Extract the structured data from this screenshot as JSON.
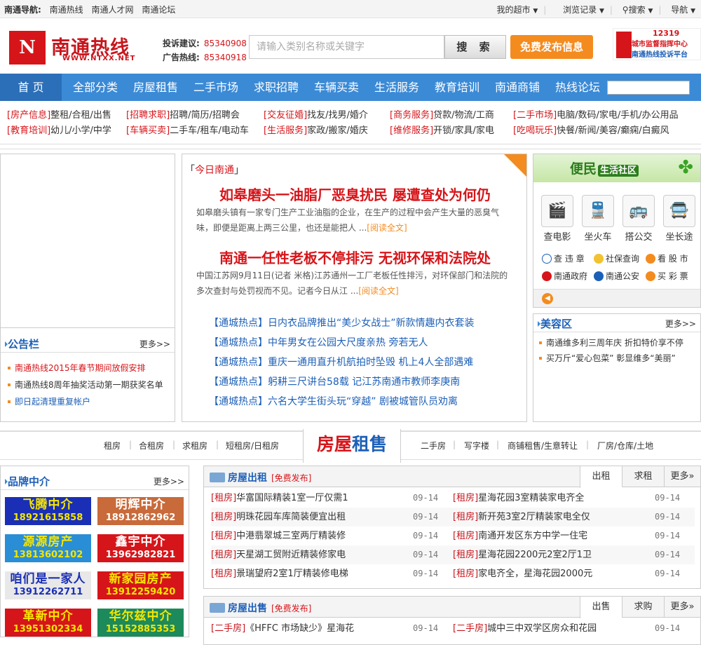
{
  "topbar": {
    "nav_label": "南通导航:",
    "links": [
      "南通热线",
      "南通人才网",
      "南通论坛"
    ],
    "right": [
      "我的超市",
      "浏览记录",
      "搜索",
      "导航"
    ]
  },
  "header": {
    "logo_mark": "N",
    "logo_name": "南通热线",
    "logo_url": "WWW.NTXX.NET",
    "hotline": [
      {
        "label": "投诉建议:",
        "num": "85340908"
      },
      {
        "label": "广告热线:",
        "num": "85340918"
      }
    ],
    "search_placeholder": "请输入类别名称或关键字",
    "search_button": "搜 索",
    "post_button": "免费发布信息",
    "ad": {
      "num": "12319",
      "l1": "城市监督指挥中心",
      "l2": "南通热线投诉平台"
    }
  },
  "nav": [
    "首 页",
    "全部分类",
    "房屋租售",
    "二手市场",
    "求职招聘",
    "车辆买卖",
    "生活服务",
    "教育培训",
    "南通商铺",
    "热线论坛"
  ],
  "categories": [
    [
      {
        "k": "[房产信息]",
        "v": "整租/合租/出售"
      },
      {
        "k": "[招聘求职]",
        "v": "招聘/简历/招聘会"
      },
      {
        "k": "[交友征婚]",
        "v": "找友/找男/婚介"
      },
      {
        "k": "[商务服务]",
        "v": "贷款/物流/工商"
      },
      {
        "k": "[二手市场]",
        "v": "电脑/数码/家电/手机/办公用品"
      }
    ],
    [
      {
        "k": "[教育培训]",
        "v": "幼儿/小学/中学"
      },
      {
        "k": "[车辆买卖]",
        "v": "二手车/租车/电动车"
      },
      {
        "k": "[生活服务]",
        "v": "家政/搬家/婚庆"
      },
      {
        "k": "[维修服务]",
        "v": "开锁/家具/家电"
      },
      {
        "k": "[吃喝玩乐]",
        "v": "快餐/新闻/美容/癫痫/白癜风"
      }
    ]
  ],
  "notice": {
    "title": "公告栏",
    "more": "更多>>",
    "items": [
      "南通热线2015年春节期间放假安排",
      "南通热线8周年抽奖活动第一期获奖名单",
      "即日起清理重复帐户"
    ]
  },
  "today": {
    "label_l": "「",
    "label": "今日南通",
    "label_r": "」",
    "articles": [
      {
        "title": "如皋磨头一油脂厂恶臭扰民 屡遭查处为何仍",
        "summary": "如皋磨头镇有一家专门生产工业油脂的企业，在生产的过程中会产生大量的恶臭气味，即便是距离上两三公里，也还是能把人 ...",
        "more": "[阅读全文]"
      },
      {
        "title": "南通一任性老板不停排污 无视环保和法院处",
        "summary": "中国江苏网9月11日(记者 米格)江苏通州一工厂老板任性排污，对环保部门和法院的多次查封与处罚视而不见。记者今日从江 ...",
        "more": "[阅读全文]"
      }
    ],
    "hot_tag": "【通城热点】",
    "hot": [
      "日内衣品牌推出“美少女战士”新款情趣内衣套装",
      "中年男女在公园大尺度亲热 旁若无人",
      "重庆一通用直升机航拍时坠毁 机上4人全部遇难",
      "躬耕三尺讲台58载 记江苏南通市教师李庚南",
      "六名大学生街头玩“穿越” 剧被城管队员劝离"
    ]
  },
  "community": {
    "title": "便民",
    "title2": "生活社区",
    "services": [
      {
        "icon": "🎬",
        "label": "查电影"
      },
      {
        "icon": "🚆",
        "label": "坐火车"
      },
      {
        "icon": "🚌",
        "label": "搭公交"
      },
      {
        "icon": "🚍",
        "label": "坐长途"
      }
    ],
    "links": [
      {
        "label": "查 违 章",
        "color": "#ffffff"
      },
      {
        "label": "社保查询",
        "color": "#f2c230"
      },
      {
        "label": "看 股 市",
        "color": "#f48b1f"
      },
      {
        "label": "南通政府",
        "color": "#d6151a"
      },
      {
        "label": "南通公安",
        "color": "#1c5fb7"
      },
      {
        "label": "买 彩 票",
        "color": "#f48b1f"
      }
    ]
  },
  "beauty": {
    "title": "美容区",
    "more": "更多>>",
    "items": [
      "南通维多利三周年庆 折扣特价享不停",
      "买万斤“爱心包菜” 彰显维多“美丽”"
    ]
  },
  "house": {
    "left_links": [
      "租房",
      "合租房",
      "求租房",
      "短租房/日租房"
    ],
    "title1": "房屋",
    "title2": "租售",
    "right_links": [
      "二手房",
      "写字楼",
      "商铺租售/生意转让",
      "厂房/仓库/土地"
    ]
  },
  "brand": {
    "title": "品牌中介",
    "more": "更多>>",
    "items": [
      {
        "name": "飞腾中介",
        "phone": "18921615858",
        "bg": "#1a2fb5",
        "fg": "#f5e600"
      },
      {
        "name": "明辉中介",
        "phone": "18912862962",
        "bg": "#c96a3a",
        "fg": "#ffffff"
      },
      {
        "name": "源源房产",
        "phone": "13813602102",
        "bg": "#2a8ed6",
        "fg": "#f5e600"
      },
      {
        "name": "鑫宇中介",
        "phone": "13962982821",
        "bg": "#d6151a",
        "fg": "#ffffff"
      },
      {
        "name": "咱们是一家人",
        "phone": "13912262711",
        "bg": "#e8e8e8",
        "fg": "#1a2fb5"
      },
      {
        "name": "新家园房产",
        "phone": "13912259420",
        "bg": "#d6151a",
        "fg": "#f5e600"
      },
      {
        "name": "革新中介",
        "phone": "13951302334",
        "bg": "#d6151a",
        "fg": "#f5e600"
      },
      {
        "name": "华尔兹中介",
        "phone": "15152885353",
        "bg": "#1c8a5a",
        "fg": "#f5e600"
      }
    ]
  },
  "rent": {
    "title": "房屋出租",
    "free": "[免费发布]",
    "tabs": [
      "出租",
      "求租",
      "更多"
    ],
    "left": [
      {
        "k": "[租房]",
        "t": "华富国际精装1室一厅仅需1",
        "d": "09-14"
      },
      {
        "k": "[租房]",
        "t": "明珠花园车库简装便宜出租",
        "d": "09-14"
      },
      {
        "k": "[租房]",
        "t": "中港翡翠城三室两厅精装修",
        "d": "09-14"
      },
      {
        "k": "[租房]",
        "t": "天星湖工贸附近精装修家电",
        "d": "09-14"
      },
      {
        "k": "[租房]",
        "t": "景瑞望府2室1厅精装修电梯",
        "d": "09-14"
      }
    ],
    "right": [
      {
        "k": "[租房]",
        "t": "星海花园3室精装家电齐全",
        "d": "09-14"
      },
      {
        "k": "[租房]",
        "t": "新开苑3室2厅精装家电全仅",
        "d": "09-14"
      },
      {
        "k": "[租房]",
        "t": "南通开发区东方中学一住宅",
        "d": "09-14"
      },
      {
        "k": "[租房]",
        "t": "星海花园2200元2室2厅1卫",
        "d": "09-14"
      },
      {
        "k": "[租房]",
        "t": "家电齐全，星海花园2000元",
        "d": "09-14"
      }
    ]
  },
  "sale": {
    "title": "房屋出售",
    "free": "[免费发布]",
    "tabs": [
      "出售",
      "求购",
      "更多"
    ],
    "left": [
      {
        "k": "[二手房]",
        "t": "《HFFC 市场缺少》星海花",
        "d": "09-14"
      }
    ],
    "right": [
      {
        "k": "[二手房]",
        "t": "城中三中双学区房众和花园",
        "d": "09-14"
      }
    ]
  }
}
